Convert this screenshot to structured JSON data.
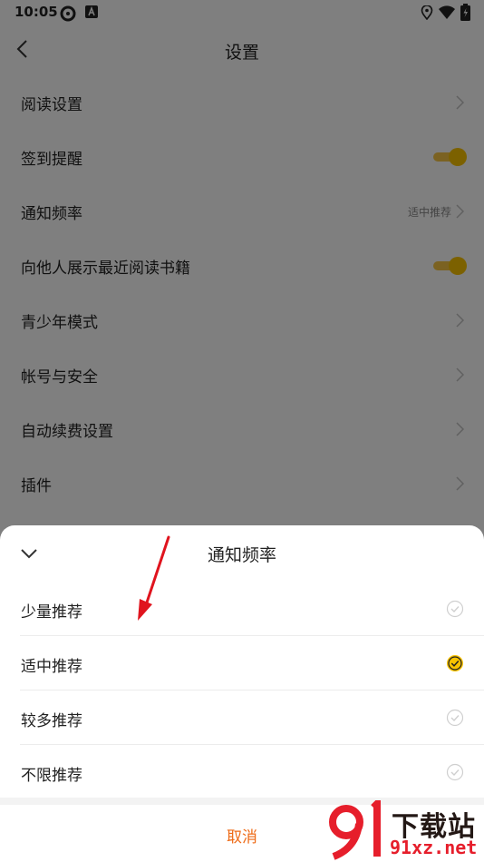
{
  "status_bar": {
    "time": "10:05",
    "icons": [
      "settings-icon",
      "font-a-icon",
      "location-icon",
      "wifi-icon",
      "battery-icon"
    ]
  },
  "header": {
    "title": "设置",
    "back_icon": "chevron-left-icon"
  },
  "settings": {
    "items": [
      {
        "label": "阅读设置",
        "type": "link"
      },
      {
        "label": "签到提醒",
        "type": "toggle",
        "on": true
      },
      {
        "label": "通知频率",
        "type": "link",
        "value": "适中推荐"
      },
      {
        "label": "向他人展示最近阅读书籍",
        "type": "toggle",
        "on": true
      },
      {
        "label": "青少年模式",
        "type": "link"
      },
      {
        "label": "帐号与安全",
        "type": "link"
      },
      {
        "label": "自动续费设置",
        "type": "link"
      },
      {
        "label": "插件",
        "type": "link"
      }
    ]
  },
  "sheet": {
    "title": "通知频率",
    "options": [
      {
        "label": "少量推荐",
        "selected": false
      },
      {
        "label": "适中推荐",
        "selected": true
      },
      {
        "label": "较多推荐",
        "selected": false
      },
      {
        "label": "不限推荐",
        "selected": false
      }
    ],
    "cancel_label": "取消"
  },
  "watermark": {
    "logo_text": "下载站",
    "url": "91xz.net"
  },
  "colors": {
    "accent": "#f8c300",
    "cancel_text": "#ee6a16",
    "watermark_red": "#e61e2b",
    "overlay": "rgba(0,0,0,0.5)"
  }
}
